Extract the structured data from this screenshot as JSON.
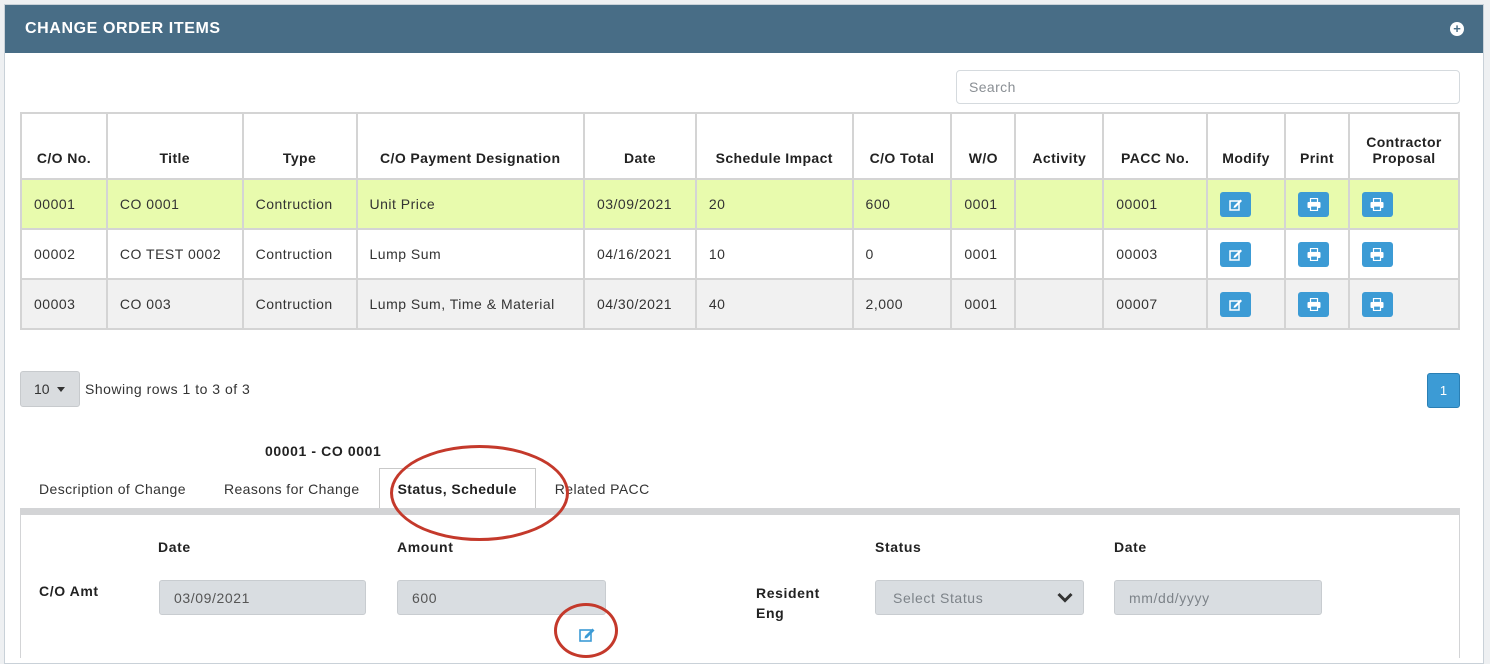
{
  "panel": {
    "title": "CHANGE ORDER ITEMS",
    "add_icon": "plus-circle-icon"
  },
  "search": {
    "placeholder": "Search"
  },
  "table": {
    "headers": [
      "C/O No.",
      "Title",
      "Type",
      "C/O Payment Designation",
      "Date",
      "Schedule Impact",
      "C/O Total",
      "W/O",
      "Activity",
      "PACC No.",
      "Modify",
      "Print",
      "Contractor Proposal"
    ],
    "rows": [
      {
        "co_no": "00001",
        "title": "CO 0001",
        "type": "Contruction",
        "payment": "Unit Price",
        "date": "03/09/2021",
        "schedule_impact": "20",
        "total": "600",
        "wo": "0001",
        "activity": "",
        "pacc": "00001"
      },
      {
        "co_no": "00002",
        "title": "CO TEST 0002",
        "type": "Contruction",
        "payment": "Lump Sum",
        "date": "04/16/2021",
        "schedule_impact": "10",
        "total": "0",
        "wo": "0001",
        "activity": "",
        "pacc": "00003"
      },
      {
        "co_no": "00003",
        "title": "CO 003",
        "type": "Contruction",
        "payment": "Lump Sum, Time & Material",
        "date": "04/30/2021",
        "schedule_impact": "40",
        "total": "2,000",
        "wo": "0001",
        "activity": "",
        "pacc": "00007"
      }
    ],
    "selected_row_color": "#e8fbad",
    "button_color": "#3c9bd5"
  },
  "pagination": {
    "page_size": "10",
    "showing": "Showing rows 1 to 3 of 3",
    "current_page": "1"
  },
  "detail": {
    "title": "00001 - CO 0001",
    "tabs": [
      "Description of Change",
      "Reasons for Change",
      "Status, Schedule",
      "Related PACC"
    ],
    "active_tab": "Status, Schedule",
    "col_date": "Date",
    "col_amount": "Amount",
    "col_status": "Status",
    "col_date2": "Date",
    "row_label": "C/O Amt",
    "date_value": "03/09/2021",
    "amount_value": "600",
    "resident_eng_label": "Resident Eng",
    "status_placeholder": "Select Status",
    "date_placeholder": "mm/dd/yyyy"
  },
  "highlight_color": "#c4392b"
}
